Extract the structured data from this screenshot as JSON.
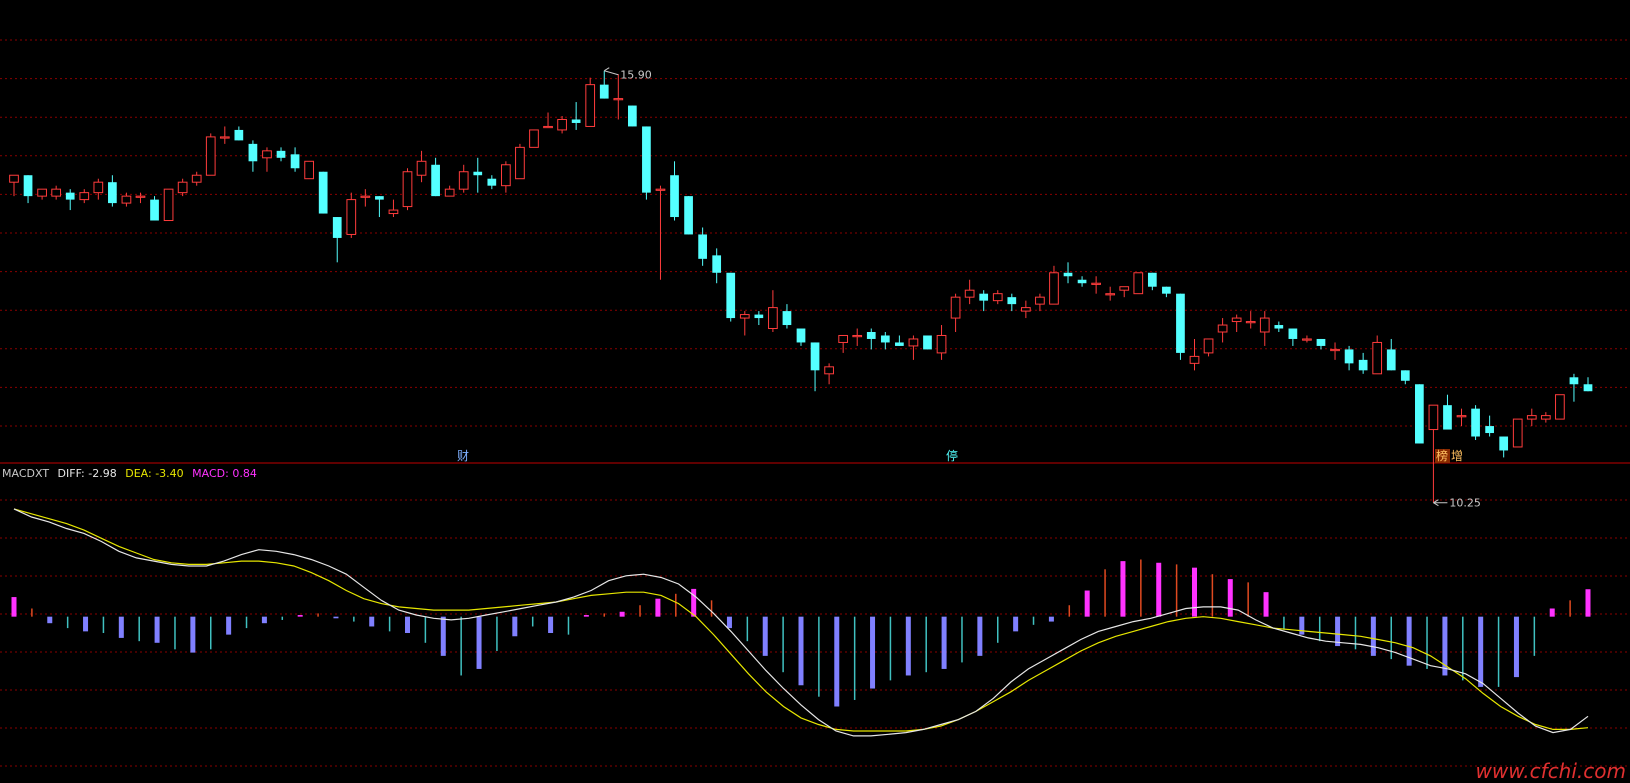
{
  "header": {
    "indicator_name": "MACDXT",
    "diff_label": "DIFF: -2.98",
    "dea_label": "DEA: -3.40",
    "macd_label": "MACD: 0.84"
  },
  "markers": {
    "high_label": "15.90",
    "low_label": "10.25",
    "event_1": "财",
    "event_2": "停",
    "event_3_a": "榜",
    "event_3_b": "增"
  },
  "watermark": "www.cfchi.com",
  "colors": {
    "background": "#000000",
    "grid": "#8a0000",
    "divider": "#c00000",
    "up": "#ff3c3c",
    "down": "#54ffff",
    "diff_line": "#e6e6e6",
    "dea_line": "#e6e600",
    "macd_pos_bright": "#ff32ff",
    "macd_pos_thin": "#e04a20",
    "macd_neg_thick": "#8080ff",
    "macd_neg_thin": "#40c0c0",
    "marker_text": "#c8c8c8",
    "watermark": "#e03030"
  },
  "chart_data": [
    {
      "type": "candlestick",
      "title": "",
      "ylim": [
        10.0,
        16.2
      ],
      "max_price": 15.9,
      "min_price": 10.25,
      "candles": [
        [
          13.7,
          13.8,
          13.5,
          13.8
        ],
        [
          13.8,
          13.8,
          13.4,
          13.5
        ],
        [
          13.5,
          13.6,
          13.45,
          13.6
        ],
        [
          13.5,
          13.65,
          13.45,
          13.6
        ],
        [
          13.55,
          13.6,
          13.3,
          13.45
        ],
        [
          13.45,
          13.6,
          13.4,
          13.55
        ],
        [
          13.55,
          13.75,
          13.45,
          13.7
        ],
        [
          13.7,
          13.8,
          13.35,
          13.4
        ],
        [
          13.4,
          13.55,
          13.35,
          13.5
        ],
        [
          13.5,
          13.55,
          13.4,
          13.5
        ],
        [
          13.45,
          13.5,
          13.15,
          13.15
        ],
        [
          13.15,
          13.6,
          13.15,
          13.6
        ],
        [
          13.55,
          13.75,
          13.5,
          13.7
        ],
        [
          13.7,
          13.85,
          13.65,
          13.8
        ],
        [
          13.8,
          14.4,
          13.8,
          14.35
        ],
        [
          14.35,
          14.5,
          14.25,
          14.35
        ],
        [
          14.45,
          14.5,
          14.3,
          14.3
        ],
        [
          14.25,
          14.3,
          13.85,
          14.0
        ],
        [
          14.05,
          14.2,
          13.85,
          14.15
        ],
        [
          14.15,
          14.2,
          14.0,
          14.05
        ],
        [
          14.1,
          14.2,
          13.85,
          13.9
        ],
        [
          13.75,
          14.0,
          13.75,
          14.0
        ],
        [
          13.85,
          13.85,
          13.25,
          13.25
        ],
        [
          13.2,
          13.2,
          12.55,
          12.9
        ],
        [
          12.95,
          13.55,
          12.9,
          13.45
        ],
        [
          13.5,
          13.6,
          13.35,
          13.5
        ],
        [
          13.5,
          13.5,
          13.2,
          13.45
        ],
        [
          13.25,
          13.45,
          13.2,
          13.3
        ],
        [
          13.35,
          13.9,
          13.3,
          13.85
        ],
        [
          13.8,
          14.15,
          13.7,
          14.0
        ],
        [
          13.95,
          14.05,
          13.5,
          13.5
        ],
        [
          13.5,
          13.65,
          13.5,
          13.6
        ],
        [
          13.6,
          13.95,
          13.55,
          13.85
        ],
        [
          13.85,
          14.05,
          13.55,
          13.8
        ],
        [
          13.75,
          13.8,
          13.6,
          13.65
        ],
        [
          13.65,
          14.0,
          13.55,
          13.95
        ],
        [
          13.75,
          14.25,
          13.75,
          14.2
        ],
        [
          14.2,
          14.45,
          14.2,
          14.45
        ],
        [
          14.5,
          14.7,
          14.5,
          14.5
        ],
        [
          14.45,
          14.65,
          14.4,
          14.6
        ],
        [
          14.6,
          14.85,
          14.45,
          14.55
        ],
        [
          14.5,
          15.2,
          14.5,
          15.1
        ],
        [
          15.1,
          15.3,
          14.9,
          14.9
        ],
        [
          14.9,
          15.25,
          14.6,
          14.9
        ],
        [
          14.8,
          14.8,
          14.5,
          14.5
        ],
        [
          14.5,
          14.5,
          13.45,
          13.55
        ],
        [
          13.6,
          13.65,
          12.3,
          13.6
        ],
        [
          13.8,
          14.0,
          13.15,
          13.2
        ],
        [
          13.5,
          13.5,
          12.95,
          12.95
        ],
        [
          12.95,
          13.05,
          12.5,
          12.6
        ],
        [
          12.65,
          12.75,
          12.25,
          12.4
        ],
        [
          12.4,
          12.4,
          11.7,
          11.75
        ],
        [
          11.75,
          11.85,
          11.5,
          11.8
        ],
        [
          11.8,
          11.85,
          11.65,
          11.75
        ],
        [
          11.6,
          12.15,
          11.55,
          11.9
        ],
        [
          11.85,
          11.95,
          11.6,
          11.65
        ],
        [
          11.6,
          11.6,
          11.35,
          11.4
        ],
        [
          11.4,
          11.4,
          10.7,
          11.0
        ],
        [
          10.95,
          11.1,
          10.8,
          11.05
        ],
        [
          11.4,
          11.5,
          11.25,
          11.5
        ],
        [
          11.5,
          11.6,
          11.35,
          11.5
        ],
        [
          11.55,
          11.6,
          11.3,
          11.45
        ],
        [
          11.5,
          11.55,
          11.3,
          11.4
        ],
        [
          11.4,
          11.5,
          11.35,
          11.35
        ],
        [
          11.35,
          11.5,
          11.15,
          11.45
        ],
        [
          11.5,
          11.5,
          11.3,
          11.3
        ],
        [
          11.25,
          11.65,
          11.15,
          11.5
        ],
        [
          11.75,
          12.1,
          11.55,
          12.05
        ],
        [
          12.05,
          12.3,
          11.95,
          12.15
        ],
        [
          12.1,
          12.15,
          11.85,
          12.0
        ],
        [
          12.0,
          12.15,
          11.95,
          12.1
        ],
        [
          12.05,
          12.1,
          11.85,
          11.95
        ],
        [
          11.85,
          12.0,
          11.75,
          11.9
        ],
        [
          11.95,
          12.1,
          11.85,
          12.05
        ],
        [
          11.95,
          12.5,
          11.95,
          12.4
        ],
        [
          12.4,
          12.55,
          12.25,
          12.35
        ],
        [
          12.3,
          12.35,
          12.2,
          12.25
        ],
        [
          12.25,
          12.35,
          12.1,
          12.25
        ],
        [
          12.1,
          12.2,
          12.0,
          12.1
        ],
        [
          12.15,
          12.2,
          12.05,
          12.2
        ],
        [
          12.1,
          12.4,
          12.1,
          12.4
        ],
        [
          12.4,
          12.4,
          12.15,
          12.2
        ],
        [
          12.2,
          12.2,
          12.05,
          12.1
        ],
        [
          12.1,
          12.1,
          11.15,
          11.25
        ],
        [
          11.1,
          11.45,
          11.0,
          11.2
        ],
        [
          11.25,
          11.45,
          11.2,
          11.45
        ],
        [
          11.55,
          11.75,
          11.4,
          11.65
        ],
        [
          11.7,
          11.8,
          11.55,
          11.75
        ],
        [
          11.7,
          11.85,
          11.6,
          11.7
        ],
        [
          11.55,
          11.85,
          11.35,
          11.75
        ],
        [
          11.65,
          11.7,
          11.55,
          11.6
        ],
        [
          11.6,
          11.6,
          11.35,
          11.45
        ],
        [
          11.45,
          11.5,
          11.4,
          11.45
        ],
        [
          11.45,
          11.45,
          11.3,
          11.35
        ],
        [
          11.3,
          11.4,
          11.15,
          11.3
        ],
        [
          11.3,
          11.35,
          11.0,
          11.1
        ],
        [
          11.15,
          11.25,
          10.95,
          11.0
        ],
        [
          10.95,
          11.5,
          10.95,
          11.4
        ],
        [
          11.3,
          11.45,
          11.0,
          11.0
        ],
        [
          11.0,
          11.0,
          10.8,
          10.85
        ],
        [
          10.8,
          10.8,
          9.95,
          9.95
        ],
        [
          10.15,
          10.5,
          9.1,
          10.5
        ],
        [
          10.5,
          10.65,
          10.2,
          10.15
        ],
        [
          10.35,
          10.45,
          10.2,
          10.35
        ],
        [
          10.45,
          10.5,
          10.0,
          10.05
        ],
        [
          10.2,
          10.35,
          10.05,
          10.1
        ],
        [
          10.05,
          10.05,
          9.75,
          9.85
        ],
        [
          9.9,
          10.3,
          9.9,
          10.3
        ],
        [
          10.3,
          10.45,
          10.2,
          10.35
        ],
        [
          10.3,
          10.4,
          10.25,
          10.35
        ],
        [
          10.3,
          10.65,
          10.3,
          10.65
        ],
        [
          10.9,
          10.95,
          10.55,
          10.8
        ],
        [
          10.8,
          10.9,
          10.7,
          10.7
        ]
      ]
    },
    {
      "type": "line",
      "title": "MACDXT",
      "ylim": [
        -5.0,
        4.0
      ],
      "series": [
        {
          "name": "DIFF",
          "values": [
            3.3,
            3.05,
            2.9,
            2.7,
            2.55,
            2.3,
            2.0,
            1.8,
            1.7,
            1.6,
            1.55,
            1.55,
            1.7,
            1.9,
            2.05,
            2.0,
            1.9,
            1.75,
            1.55,
            1.3,
            0.9,
            0.5,
            0.2,
            0.05,
            -0.05,
            -0.1,
            -0.05,
            0.05,
            0.15,
            0.25,
            0.35,
            0.45,
            0.6,
            0.8,
            1.1,
            1.25,
            1.3,
            1.2,
            1.0,
            0.6,
            0.1,
            -0.45,
            -1.05,
            -1.65,
            -2.2,
            -2.7,
            -3.15,
            -3.5,
            -3.65,
            -3.65,
            -3.6,
            -3.55,
            -3.45,
            -3.3,
            -3.15,
            -2.9,
            -2.5,
            -2.0,
            -1.6,
            -1.3,
            -1.0,
            -0.7,
            -0.45,
            -0.3,
            -0.15,
            -0.05,
            0.1,
            0.25,
            0.3,
            0.3,
            0.2,
            -0.1,
            -0.35,
            -0.5,
            -0.65,
            -0.75,
            -0.8,
            -0.85,
            -0.95,
            -1.1,
            -1.3,
            -1.5,
            -1.6,
            -1.75,
            -2.05,
            -2.5,
            -2.95,
            -3.35,
            -3.55,
            -3.45,
            -3.05
          ]
        },
        {
          "name": "DEA",
          "values": [
            3.3,
            3.15,
            3.0,
            2.85,
            2.65,
            2.4,
            2.15,
            1.95,
            1.75,
            1.65,
            1.6,
            1.6,
            1.65,
            1.7,
            1.7,
            1.65,
            1.55,
            1.35,
            1.1,
            0.8,
            0.55,
            0.4,
            0.3,
            0.25,
            0.2,
            0.2,
            0.2,
            0.25,
            0.3,
            0.35,
            0.4,
            0.45,
            0.55,
            0.65,
            0.7,
            0.75,
            0.75,
            0.65,
            0.4,
            0.0,
            -0.55,
            -1.15,
            -1.75,
            -2.3,
            -2.75,
            -3.1,
            -3.3,
            -3.45,
            -3.5,
            -3.5,
            -3.5,
            -3.5,
            -3.45,
            -3.35,
            -3.15,
            -2.9,
            -2.6,
            -2.3,
            -1.95,
            -1.65,
            -1.35,
            -1.05,
            -0.8,
            -0.6,
            -0.45,
            -0.3,
            -0.15,
            -0.05,
            0.0,
            -0.05,
            -0.15,
            -0.25,
            -0.35,
            -0.4,
            -0.45,
            -0.5,
            -0.55,
            -0.6,
            -0.7,
            -0.8,
            -0.95,
            -1.2,
            -1.55,
            -1.9,
            -2.35,
            -2.75,
            -3.05,
            -3.3,
            -3.45,
            -3.45,
            -3.4
          ]
        }
      ],
      "macd_bars": [
        0.6,
        0.25,
        -0.2,
        -0.35,
        -0.45,
        -0.5,
        -0.65,
        -0.75,
        -0.8,
        -1.0,
        -1.1,
        -1.0,
        -0.55,
        -0.35,
        -0.2,
        -0.1,
        0.05,
        0.1,
        -0.05,
        -0.15,
        -0.3,
        -0.45,
        -0.5,
        -0.8,
        -1.2,
        -1.8,
        -1.6,
        -1.05,
        -0.6,
        -0.3,
        -0.5,
        -0.55,
        0.05,
        0.1,
        0.15,
        0.35,
        0.55,
        0.7,
        0.85,
        0.5,
        -0.35,
        -0.75,
        -1.2,
        -1.7,
        -2.1,
        -2.45,
        -2.75,
        -2.55,
        -2.2,
        -1.95,
        -1.8,
        -1.7,
        -1.6,
        -1.4,
        -1.2,
        -0.8,
        -0.45,
        -0.25,
        -0.15,
        0.35,
        0.8,
        1.45,
        1.7,
        1.75,
        1.65,
        1.6,
        1.5,
        1.3,
        1.15,
        1.05,
        0.75,
        -0.4,
        -0.55,
        -0.75,
        -0.9,
        -1.0,
        -1.2,
        -1.3,
        -1.5,
        -1.6,
        -1.8,
        -1.95,
        -2.15,
        -2.15,
        -1.85,
        -1.2,
        0.25,
        0.5,
        0.84
      ]
    }
  ]
}
